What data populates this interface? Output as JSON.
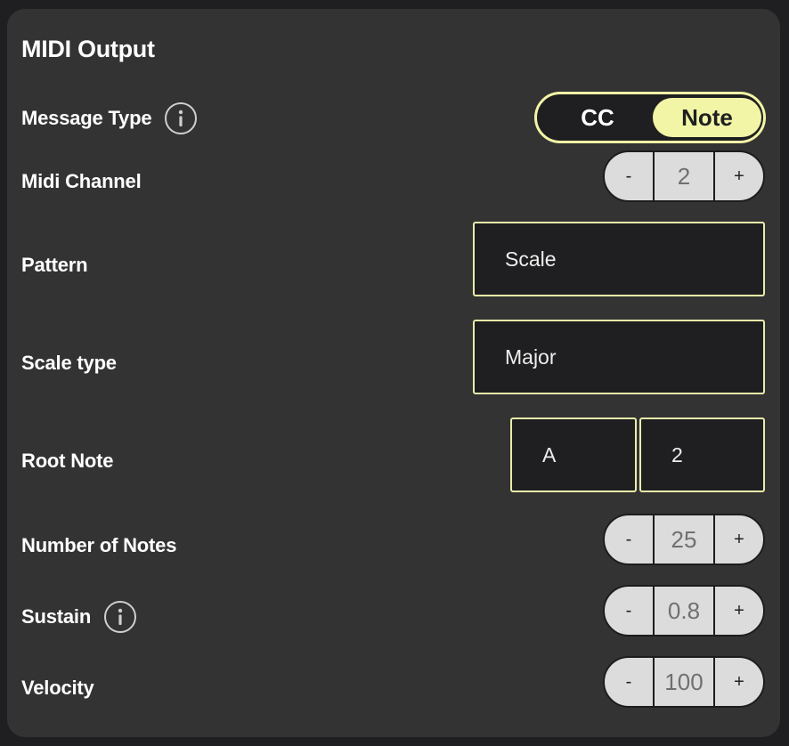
{
  "panel": {
    "title": "MIDI Output"
  },
  "message_type": {
    "label": "Message Type",
    "options": [
      "CC",
      "Note"
    ],
    "selected": "Note"
  },
  "midi_channel": {
    "label": "Midi Channel",
    "minus": "-",
    "value": "2",
    "plus": "+"
  },
  "pattern": {
    "label": "Pattern",
    "value": "Scale"
  },
  "scale_type": {
    "label": "Scale type",
    "value": "Major"
  },
  "root_note": {
    "label": "Root Note",
    "note": "A",
    "octave": "2"
  },
  "number_of_notes": {
    "label": "Number of Notes",
    "minus": "-",
    "value": "25",
    "plus": "+"
  },
  "sustain": {
    "label": "Sustain",
    "minus": "-",
    "value": "0.8",
    "plus": "+"
  },
  "velocity": {
    "label": "Velocity",
    "minus": "-",
    "value": "100",
    "plus": "+"
  },
  "colors": {
    "accent": "#f2f5a6",
    "panel_bg": "#333333",
    "field_bg": "#1f1f21",
    "stepper_bg": "#dcdcdc"
  },
  "icons": {
    "info": "info-circle-icon"
  }
}
